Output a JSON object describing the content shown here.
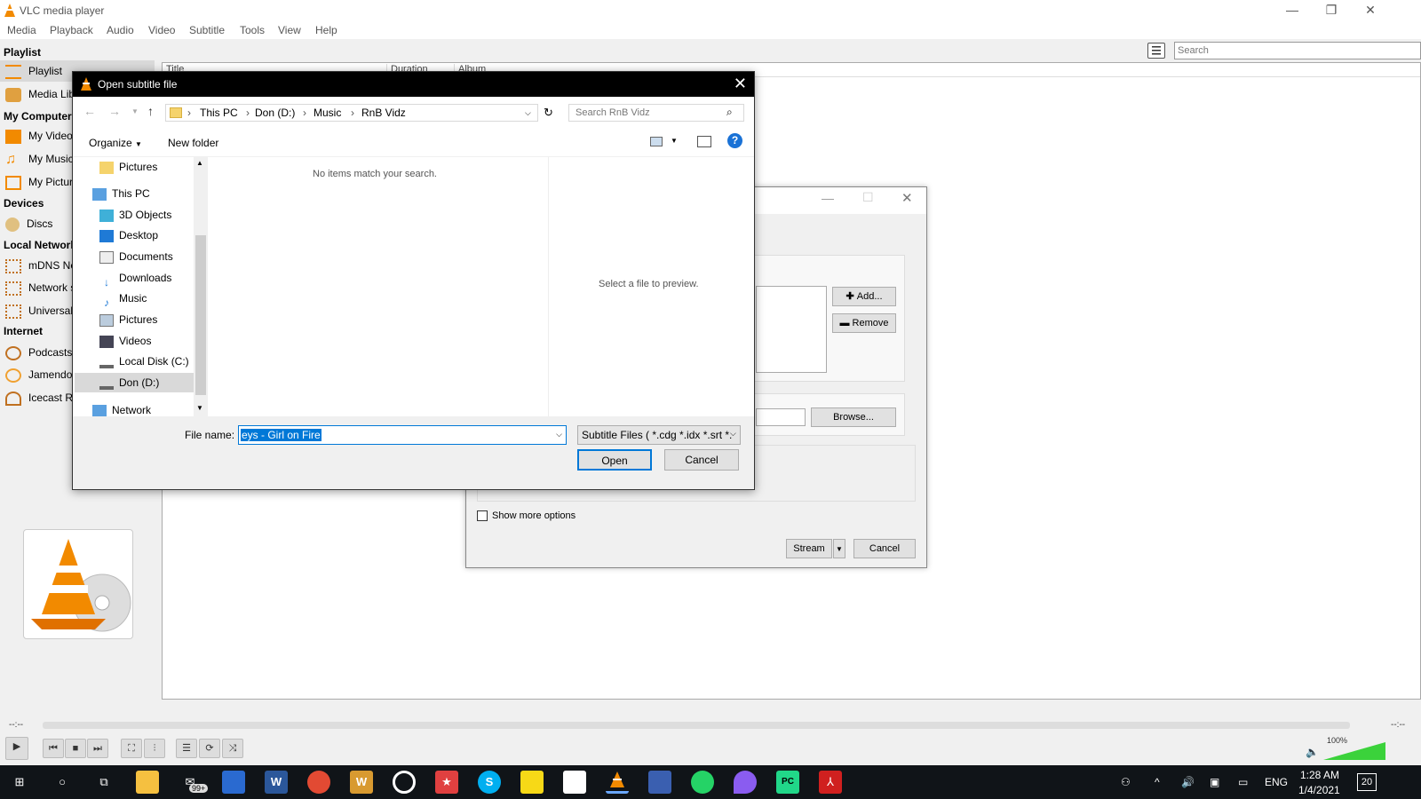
{
  "vlc": {
    "title": "VLC media player",
    "window_controls": {
      "minimize": "—",
      "restore": "❐",
      "close": "✕"
    },
    "menu": [
      "Media",
      "Playback",
      "Audio",
      "Video",
      "Subtitle",
      "Tools",
      "View",
      "Help"
    ],
    "search_placeholder": "Search",
    "playlist_columns": [
      "Title",
      "Duration",
      "Album"
    ],
    "sidebar": {
      "header_playlist": "Playlist",
      "playlist_items": [
        "Playlist",
        "Media Library"
      ],
      "header_my_computer": "My Computer",
      "my_computer_items": [
        "My Videos",
        "My Music",
        "My Pictures"
      ],
      "header_devices": "Devices",
      "devices_items": [
        "Discs"
      ],
      "header_local_network": "Local Network",
      "local_network_items": [
        "mDNS Network Discovery",
        "Network streams (SAP)",
        "Universal Plug'n'Play"
      ],
      "header_internet": "Internet",
      "internet_items": [
        "Podcasts",
        "Jamendo Selections",
        "Icecast Radio Directory"
      ]
    },
    "time_left": "--:--",
    "time_right": "--:--",
    "volume_label": "100%",
    "volume_level": 1.0
  },
  "stream_dialog": {
    "add_label": "Add...",
    "remove_label": "Remove",
    "browse_label": "Browse...",
    "show_more_options": "Show more options",
    "stream_label": "Stream",
    "cancel_label": "Cancel"
  },
  "open_dialog": {
    "title": "Open subtitle file",
    "breadcrumb": [
      "This PC",
      "Don (D:)",
      "Music",
      "RnB Vidz"
    ],
    "search_placeholder": "Search RnB Vidz",
    "organize_label": "Organize",
    "new_folder_label": "New folder",
    "nav_items": [
      "Pictures",
      "This PC",
      "3D Objects",
      "Desktop",
      "Documents",
      "Downloads",
      "Music",
      "Pictures",
      "Videos",
      "Local Disk (C:)",
      "Don (D:)",
      "Network"
    ],
    "empty_message": "No items match your search.",
    "preview_message": "Select a file to preview.",
    "file_name_label": "File name:",
    "file_name_value": "eys - Girl on Fire",
    "file_type_value": "Subtitle Files ( *.cdg *.idx *.srt *.",
    "open_label": "Open",
    "cancel_label": "Cancel"
  },
  "taskbar": {
    "mail_badge": "99+",
    "lang": "ENG",
    "time": "1:28 AM",
    "date": "1/4/2021",
    "notification_count": "20"
  }
}
